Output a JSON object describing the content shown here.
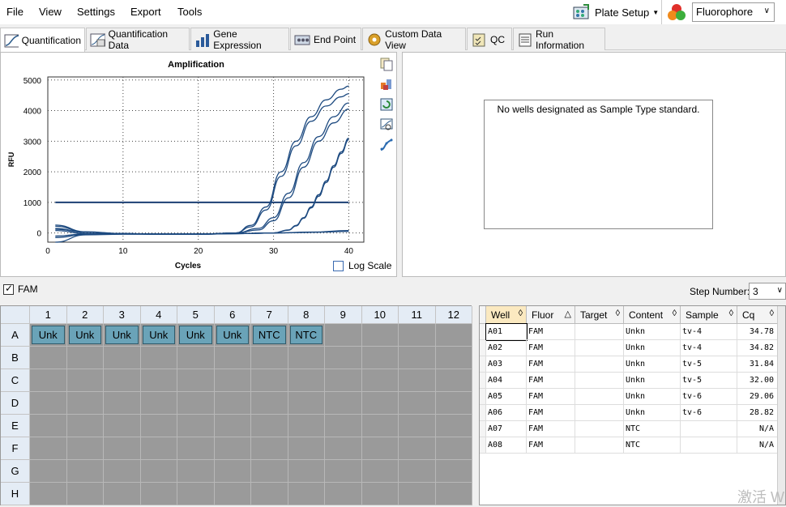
{
  "menu": [
    "File",
    "View",
    "Settings",
    "Export",
    "Tools"
  ],
  "toolbar": {
    "plate_setup_label": "Plate Setup",
    "fluorophore_value": "Fluorophore"
  },
  "tabs": [
    {
      "label": "Quantification",
      "active": true
    },
    {
      "label": "Quantification Data",
      "active": false
    },
    {
      "label": "Gene Expression",
      "active": false
    },
    {
      "label": "End Point",
      "active": false
    },
    {
      "label": "Custom Data View",
      "active": false
    },
    {
      "label": "QC",
      "active": false
    },
    {
      "label": "Run Information",
      "active": false
    }
  ],
  "chart_data": {
    "type": "line",
    "title": "Amplification",
    "xlabel": "Cycles",
    "ylabel": "RFU",
    "xlim": [
      0,
      42
    ],
    "ylim": [
      -300,
      5100
    ],
    "xticks": [
      0,
      10,
      20,
      30,
      40
    ],
    "yticks": [
      0,
      1000,
      2000,
      3000,
      4000,
      5000
    ],
    "grid": true,
    "threshold": 1000,
    "series": [
      {
        "x": [
          1,
          5,
          10,
          15,
          20,
          25,
          27,
          29,
          31,
          33,
          35,
          37,
          39,
          40
        ],
        "y": [
          260,
          40,
          -20,
          -40,
          -40,
          0,
          250,
          850,
          2000,
          3000,
          3800,
          4350,
          4700,
          4800
        ]
      },
      {
        "x": [
          1,
          5,
          10,
          15,
          20,
          25,
          27,
          29,
          31,
          33,
          35,
          37,
          39,
          40
        ],
        "y": [
          220,
          30,
          -20,
          -40,
          -40,
          0,
          200,
          750,
          1850,
          2850,
          3650,
          4150,
          4450,
          4550
        ]
      },
      {
        "x": [
          1,
          5,
          10,
          15,
          20,
          25,
          28,
          30,
          32,
          34,
          36,
          38,
          40
        ],
        "y": [
          150,
          20,
          -20,
          -40,
          -40,
          0,
          150,
          500,
          1300,
          2300,
          3150,
          3800,
          4250
        ]
      },
      {
        "x": [
          1,
          5,
          10,
          15,
          20,
          25,
          28,
          30,
          32,
          34,
          36,
          38,
          40
        ],
        "y": [
          120,
          20,
          -20,
          -40,
          -40,
          0,
          100,
          400,
          1150,
          2150,
          3000,
          3600,
          4050
        ]
      },
      {
        "x": [
          1,
          5,
          10,
          15,
          20,
          25,
          30,
          32,
          33,
          34,
          35,
          36,
          37,
          38,
          39,
          40
        ],
        "y": [
          -300,
          -60,
          -40,
          -40,
          -40,
          -20,
          0,
          100,
          250,
          500,
          850,
          1250,
          1700,
          2200,
          2650,
          3100
        ]
      },
      {
        "x": [
          1,
          5,
          10,
          15,
          20,
          25,
          30,
          32,
          33,
          34,
          35,
          36,
          37,
          38,
          39,
          40
        ],
        "y": [
          80,
          -20,
          -30,
          -40,
          -40,
          -20,
          0,
          90,
          230,
          480,
          820,
          1200,
          1650,
          2150,
          2600,
          3050
        ]
      },
      {
        "x": [
          1,
          5,
          10,
          15,
          20,
          25,
          30,
          35,
          40
        ],
        "y": [
          -150,
          -50,
          -30,
          -30,
          -30,
          -20,
          0,
          20,
          50
        ]
      },
      {
        "x": [
          1,
          5,
          10,
          15,
          20,
          25,
          30,
          35,
          40
        ],
        "y": [
          -100,
          -30,
          -30,
          -30,
          -30,
          -20,
          0,
          30,
          80
        ]
      }
    ]
  },
  "chart_tools": [
    "copy-icon",
    "export-icon",
    "refresh-icon",
    "zoom-icon",
    "curve-icon"
  ],
  "log_scale_label": "Log Scale",
  "standard_curve_message": "No wells designated as Sample Type standard.",
  "fam_label": "FAM",
  "step": {
    "label": "Step Number:",
    "value": "3"
  },
  "plate": {
    "columns": [
      "1",
      "2",
      "3",
      "4",
      "5",
      "6",
      "7",
      "8",
      "9",
      "10",
      "11",
      "12"
    ],
    "rows": [
      "A",
      "B",
      "C",
      "D",
      "E",
      "F",
      "G",
      "H"
    ],
    "row_a_wells": [
      "Unk",
      "Unk",
      "Unk",
      "Unk",
      "Unk",
      "Unk",
      "NTC",
      "NTC"
    ]
  },
  "results": {
    "headers": [
      "Well",
      "Fluor",
      "Target",
      "Content",
      "Sample",
      "Cq"
    ],
    "rows": [
      [
        "A01",
        "FAM",
        "",
        "Unkn",
        "tv-4",
        "34.78"
      ],
      [
        "A02",
        "FAM",
        "",
        "Unkn",
        "tv-4",
        "34.82"
      ],
      [
        "A03",
        "FAM",
        "",
        "Unkn",
        "tv-5",
        "31.84"
      ],
      [
        "A04",
        "FAM",
        "",
        "Unkn",
        "tv-5",
        "32.00"
      ],
      [
        "A05",
        "FAM",
        "",
        "Unkn",
        "tv-6",
        "29.06"
      ],
      [
        "A06",
        "FAM",
        "",
        "Unkn",
        "tv-6",
        "28.82"
      ],
      [
        "A07",
        "FAM",
        "",
        "NTC",
        "",
        "N/A"
      ],
      [
        "A08",
        "FAM",
        "",
        "NTC",
        "",
        "N/A"
      ]
    ]
  },
  "watermark": "激活 W"
}
